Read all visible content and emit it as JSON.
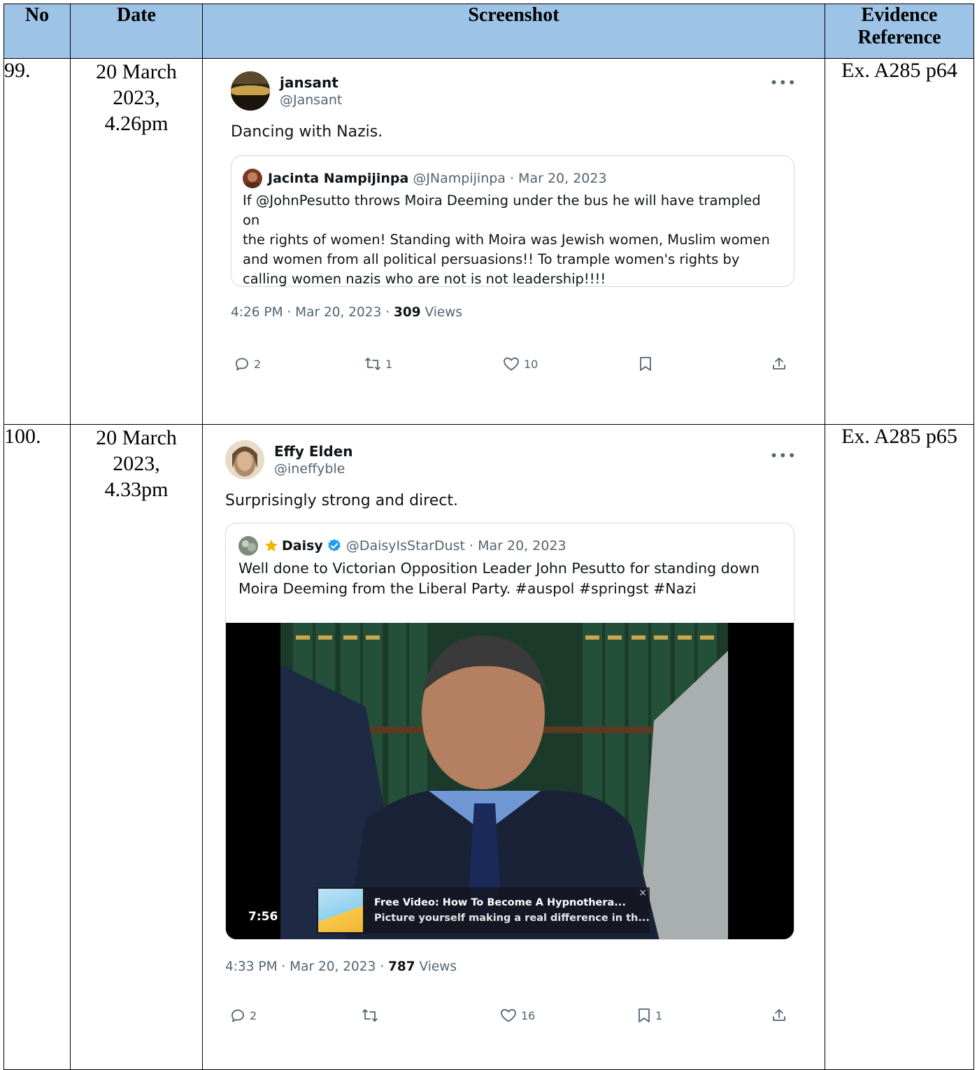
{
  "headers": {
    "no": "No",
    "date": "Date",
    "screenshot": "Screenshot",
    "reference_line1": "Evidence",
    "reference_line2": "Reference"
  },
  "rows": [
    {
      "no": "99.",
      "date_line1": "20 March",
      "date_line2": "2023,",
      "date_line3": "4.26pm",
      "reference": "Ex. A285 p64",
      "tweet": {
        "display_name": "jansant",
        "handle": "@Jansant",
        "text": "Dancing with Nazis.",
        "quote": {
          "display_name": "Jacinta Nampijinpa",
          "handle_date": "@JNampijinpa · Mar 20, 2023",
          "lines": [
            "If @JohnPesutto throws Moira Deeming under the bus he will have trampled on",
            "the rights of women! Standing with Moira was Jewish women, Muslim women",
            "and women from all political persuasions!! To trample women's rights by",
            "calling women nazis who are not is not leadership!!!!"
          ]
        },
        "meta_prefix": "4:26 PM · Mar 20, 2023 · ",
        "views_count": "309",
        "views_label": " Views",
        "replies": "2",
        "reposts": "1",
        "likes": "10",
        "bookmarks": ""
      }
    },
    {
      "no": "100.",
      "date_line1": "20 March",
      "date_line2": "2023,",
      "date_line3": "4.33pm",
      "reference": "Ex. A285 p65",
      "tweet": {
        "display_name": "Effy Elden",
        "handle": "@ineffyble",
        "text": "Surprisingly strong and direct.",
        "quote": {
          "display_name": "Daisy",
          "handle_date": "@DaisyIsStarDust · Mar 20, 2023",
          "lines": [
            "Well done to Victorian Opposition Leader John Pesutto for standing down",
            "Moira Deeming from the Liberal Party. #auspol #springst #Nazi"
          ],
          "video_duration": "7:56",
          "promo_title": "Free Video: How To Become A Hypnothera...",
          "promo_subtitle": "Picture yourself making a real difference in th..."
        },
        "meta_prefix": "4:33 PM · Mar 20, 2023 · ",
        "views_count": "787",
        "views_label": " Views",
        "replies": "2",
        "reposts": "",
        "likes": "16",
        "bookmarks": "1"
      }
    }
  ],
  "colors": {
    "header_bg": "#9dc3e6",
    "secondary_text": "#536471",
    "verified_blue": "#1d9bf0",
    "star_yellow": "#f4b400"
  }
}
